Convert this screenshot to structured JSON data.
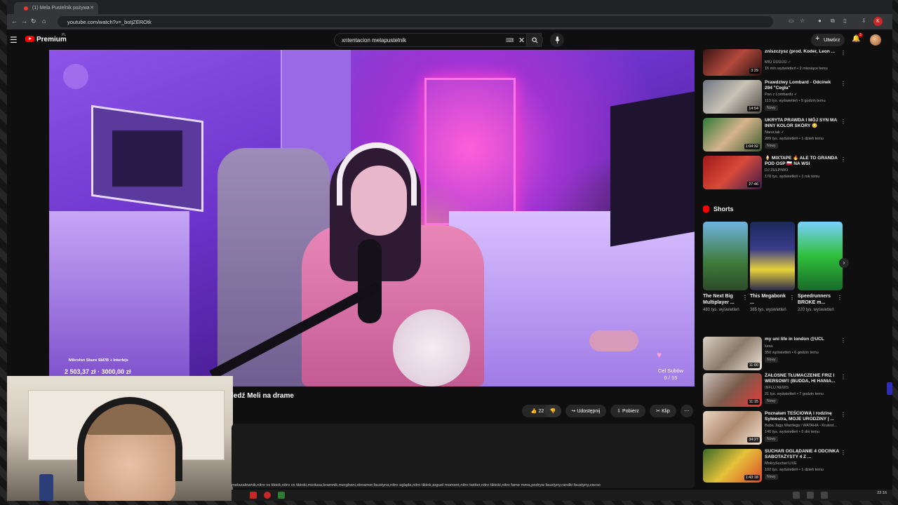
{
  "browser": {
    "tab_title": "(1) Mela Pustelnik pożywa",
    "url": "youtube.com/watch?v=_botjZEROtk"
  },
  "header": {
    "logo_text": "Premium",
    "logo_region": "PL",
    "search_value": "xntentacion melapustelnik",
    "create_label": "Utwórz",
    "notification_count": "3"
  },
  "video": {
    "overlay_mic": "Mikrofon Shure SM7B + Interfejs",
    "overlay_goal": "2 503,37 zł · 3000,00 zł",
    "overlay_subs_label": "Cel Subów",
    "overlay_subs_value": "0 / 15",
    "title": "ledź Meli na drame",
    "likes": "22",
    "share_label": "Udostępnij",
    "download_label": "Pobierz",
    "clip_label": "Klip",
    "tags": "melazalewnik,nitro vs tiktok,nitro vs tiktoki,medusa,kramnik,merghani,streamer,faustyna,nitro ogląda,nitro tiktok,arguel moment,nitro twitter,nitro tiktoki,nitro fame mma,podryw faustyny,randki faustyny,zavoo"
  },
  "recommendations": [
    {
      "title": "zniszczysz (prod. Koder, Leon ...",
      "channel": "MIŪ ŪŪŪŪŪ ✓",
      "meta": "16 mln wyświetleń • 2 miesiące temu",
      "duration": "3:29",
      "badge": ""
    },
    {
      "title": "Prawdziwy Lombard - Odcinek 294 \"Cegła\"",
      "channel": "Pan z Lombardu ✓",
      "meta": "113 tys. wyświetleń • 5 godzin temu",
      "duration": "14:54",
      "badge": "Nowy"
    },
    {
      "title": "UKRYTA PRAWDA I MÓJ SYN MA INNY KOLOR SKÓRY 😳",
      "channel": "Naruciak ✓",
      "meta": "209 tys. wyświetleń • 1 dzień temu",
      "duration": "1:04:32",
      "badge": "Nowy"
    },
    {
      "title": "🍦 MIXTAPE 🔥 ALE TO GRANDA POD OSP 🇵🇱 NA WSI",
      "channel": "DJ ZULPIWO",
      "meta": "170 tys. wyświetleń • 1 rok temu",
      "duration": "27:46",
      "badge": ""
    }
  ],
  "shorts": {
    "heading": "Shorts",
    "items": [
      {
        "title": "The Next Big Multiplayer ...",
        "views": "480 tys. wyświetleń"
      },
      {
        "title": "This Megabonk ...",
        "views": "385 tys. wyświetleń"
      },
      {
        "title": "Speedrunners BROKE m...",
        "views": "220 tys. wyświetleń"
      }
    ]
  },
  "recommendations2": [
    {
      "title": "my uni life in london @UCL",
      "channel": "luisa",
      "meta": "350 wyświetleń • 6 godzin temu",
      "duration": "11:00",
      "badge": "Nowy"
    },
    {
      "title": "ŻAŁOSNE TŁUMACZENIE FRIZ I WERSOW!! (BUDDA, HI HANIA...",
      "channel": "INFLU NEWS",
      "meta": "21 tys. wyświetleń • 7 godzin temu",
      "duration": "11:15",
      "badge": "Nowy"
    },
    {
      "title": "Poznałam TEŚCIOWĄ i rodzinę Sylwestra, MOJE URODZINY | ...",
      "channel": "Baba Jaga Wardega i WATAHA - Krulest...",
      "meta": "140 tys. wyświetleń • 5 dni temu",
      "duration": "34:27",
      "badge": "Nowy"
    },
    {
      "title": "SUCHAR OGLĄDANIE 4 ODCINKA SABOTAŻYSTY 4 Z ...",
      "channel": "MokrySuchar LIVE",
      "meta": "102 tys. wyświetleń • 1 dzień temu",
      "duration": "1:43:18",
      "badge": "Nowy"
    }
  ],
  "taskbar": {
    "time": "22:16"
  },
  "colors": {
    "accent": "#ff0000",
    "bg": "#0f0f0f",
    "pill": "#272727"
  }
}
